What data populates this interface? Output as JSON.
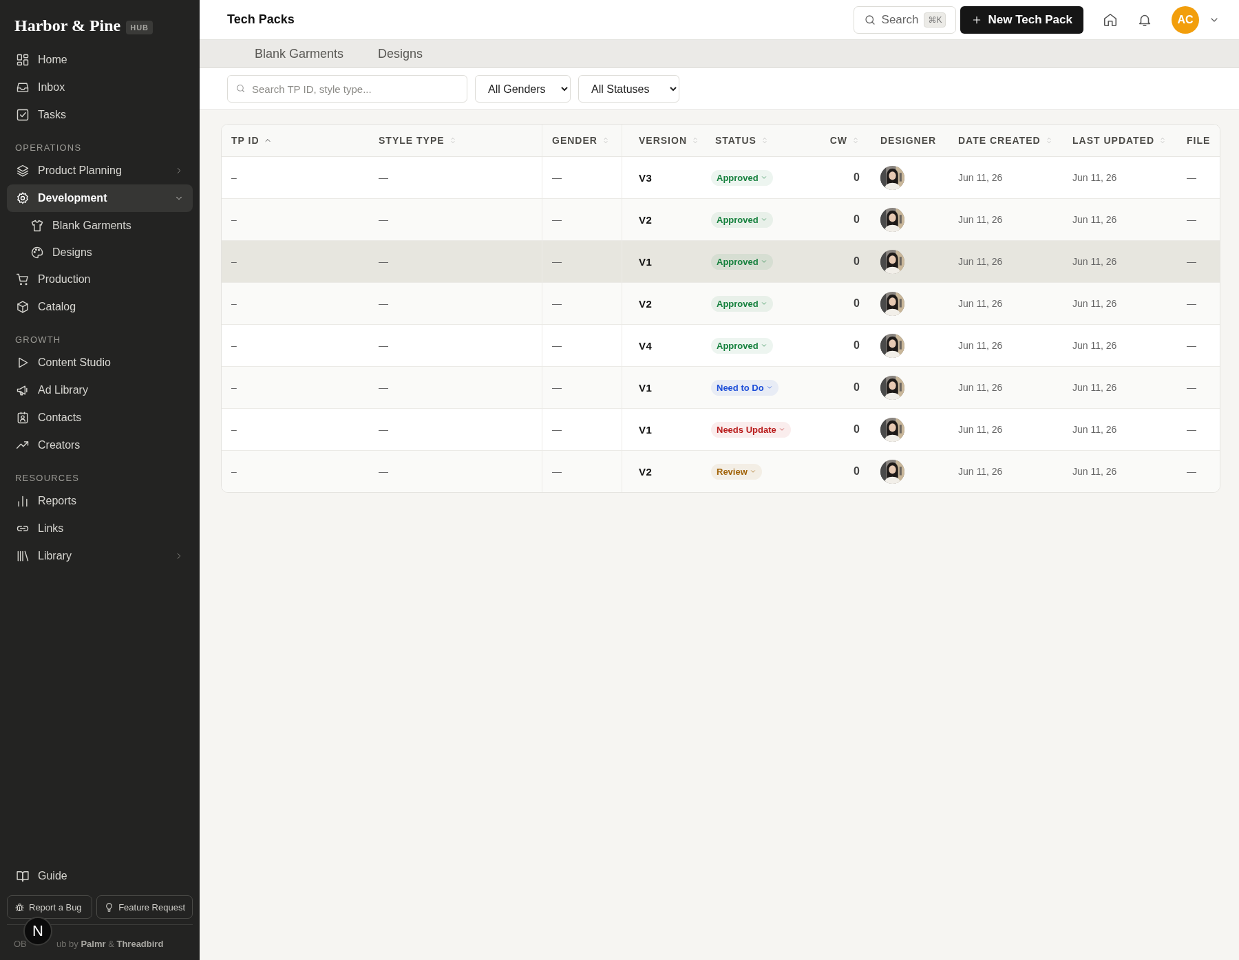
{
  "sidebar": {
    "brand": "Harbor & Pine",
    "badge": "HUB",
    "sections": [
      {
        "items": [
          {
            "label": "Home",
            "kind": "link"
          },
          {
            "label": "Inbox",
            "kind": "link"
          },
          {
            "label": "Tasks",
            "kind": "link"
          }
        ]
      },
      {
        "heading": "OPERATIONS",
        "items": [
          {
            "label": "Product Planning",
            "kind": "group",
            "expanded": false,
            "selected": false
          },
          {
            "label": "Development",
            "kind": "group",
            "expanded": true,
            "selected": true,
            "children": [
              {
                "label": "Blank Garments"
              },
              {
                "label": "Designs"
              }
            ]
          },
          {
            "label": "Production",
            "kind": "link"
          },
          {
            "label": "Catalog",
            "kind": "link"
          }
        ]
      },
      {
        "heading": "GROWTH",
        "items": [
          {
            "label": "Content Studio",
            "kind": "link"
          },
          {
            "label": "Ad Library",
            "kind": "link"
          },
          {
            "label": "Contacts",
            "kind": "link"
          },
          {
            "label": "Creators",
            "kind": "link"
          }
        ]
      },
      {
        "heading": "RESOURCES",
        "items": [
          {
            "label": "Reports",
            "kind": "link"
          },
          {
            "label": "Links",
            "kind": "link"
          },
          {
            "label": "Library",
            "kind": "group",
            "expanded": false,
            "selected": false
          }
        ]
      }
    ],
    "guide": "Guide",
    "buttons": [
      "Report a Bug",
      "Feature Request"
    ],
    "dev_badge": "N",
    "footer": {
      "lead": "OB",
      "text": "ub by **Palmr** & **Threadbird**"
    }
  },
  "header": {
    "title": "Tech Packs",
    "search": {
      "label": "Search",
      "shortcut": "⌘K"
    },
    "primary_button": "New Tech Pack",
    "avatar": "AC"
  },
  "tabs": [
    {
      "label": "Blank Garments",
      "selected": false
    },
    {
      "label": "Designs",
      "selected": false
    }
  ],
  "filters": {
    "search": {
      "placeholder": "Search TP ID, style type..."
    },
    "selects": [
      "All Genders",
      "All Statuses"
    ]
  },
  "table": {
    "columns": [
      {
        "label": "TP ID",
        "sortable": true,
        "sorted": true
      },
      {
        "label": "STYLE TYPE",
        "sortable": true,
        "sorted": false
      },
      {
        "label": "GENDER",
        "sortable": true,
        "sorted": false
      },
      {
        "label": "VERSION",
        "sortable": true,
        "sorted": false
      },
      {
        "label": "STATUS",
        "sortable": true,
        "sorted": false
      },
      {
        "label": "CW",
        "sortable": true,
        "sorted": false
      },
      {
        "label": "DESIGNER",
        "sortable": false
      },
      {
        "label": "DATE CREATED",
        "sortable": true,
        "sorted": false
      },
      {
        "label": "LAST UPDATED",
        "sortable": true,
        "sorted": false
      },
      {
        "label": "FILE",
        "sortable": false
      }
    ],
    "rows": [
      {
        "tp_id": "–",
        "style_type": "—",
        "gender": "—",
        "version": "V3",
        "status": {
          "label": "Approved",
          "color": "#15803d"
        },
        "cw": "0",
        "created": "Jun 11, 26",
        "updated": "Jun 11, 26",
        "file": "—",
        "selected": false
      },
      {
        "tp_id": "–",
        "style_type": "—",
        "gender": "—",
        "version": "V2",
        "status": {
          "label": "Approved",
          "color": "#15803d"
        },
        "cw": "0",
        "created": "Jun 11, 26",
        "updated": "Jun 11, 26",
        "file": "—",
        "selected": false
      },
      {
        "tp_id": "–",
        "style_type": "—",
        "gender": "—",
        "version": "V1",
        "status": {
          "label": "Approved",
          "color": "#15803d"
        },
        "cw": "0",
        "created": "Jun 11, 26",
        "updated": "Jun 11, 26",
        "file": "—",
        "selected": true
      },
      {
        "tp_id": "–",
        "style_type": "—",
        "gender": "—",
        "version": "V2",
        "status": {
          "label": "Approved",
          "color": "#15803d"
        },
        "cw": "0",
        "created": "Jun 11, 26",
        "updated": "Jun 11, 26",
        "file": "—",
        "selected": false
      },
      {
        "tp_id": "–",
        "style_type": "—",
        "gender": "—",
        "version": "V4",
        "status": {
          "label": "Approved",
          "color": "#15803d"
        },
        "cw": "0",
        "created": "Jun 11, 26",
        "updated": "Jun 11, 26",
        "file": "—",
        "selected": false
      },
      {
        "tp_id": "–",
        "style_type": "—",
        "gender": "—",
        "version": "V1",
        "status": {
          "label": "Need to Do",
          "color": "#1d4ed8"
        },
        "cw": "0",
        "created": "Jun 11, 26",
        "updated": "Jun 11, 26",
        "file": "—",
        "selected": false
      },
      {
        "tp_id": "–",
        "style_type": "—",
        "gender": "—",
        "version": "V1",
        "status": {
          "label": "Needs Update",
          "color": "#b91c1c"
        },
        "cw": "0",
        "created": "Jun 11, 26",
        "updated": "Jun 11, 26",
        "file": "—",
        "selected": false
      },
      {
        "tp_id": "–",
        "style_type": "—",
        "gender": "—",
        "version": "V2",
        "status": {
          "label": "Review",
          "color": "#a16207"
        },
        "cw": "0",
        "created": "Jun 11, 26",
        "updated": "Jun 11, 26",
        "file": "—",
        "selected": false
      }
    ]
  }
}
